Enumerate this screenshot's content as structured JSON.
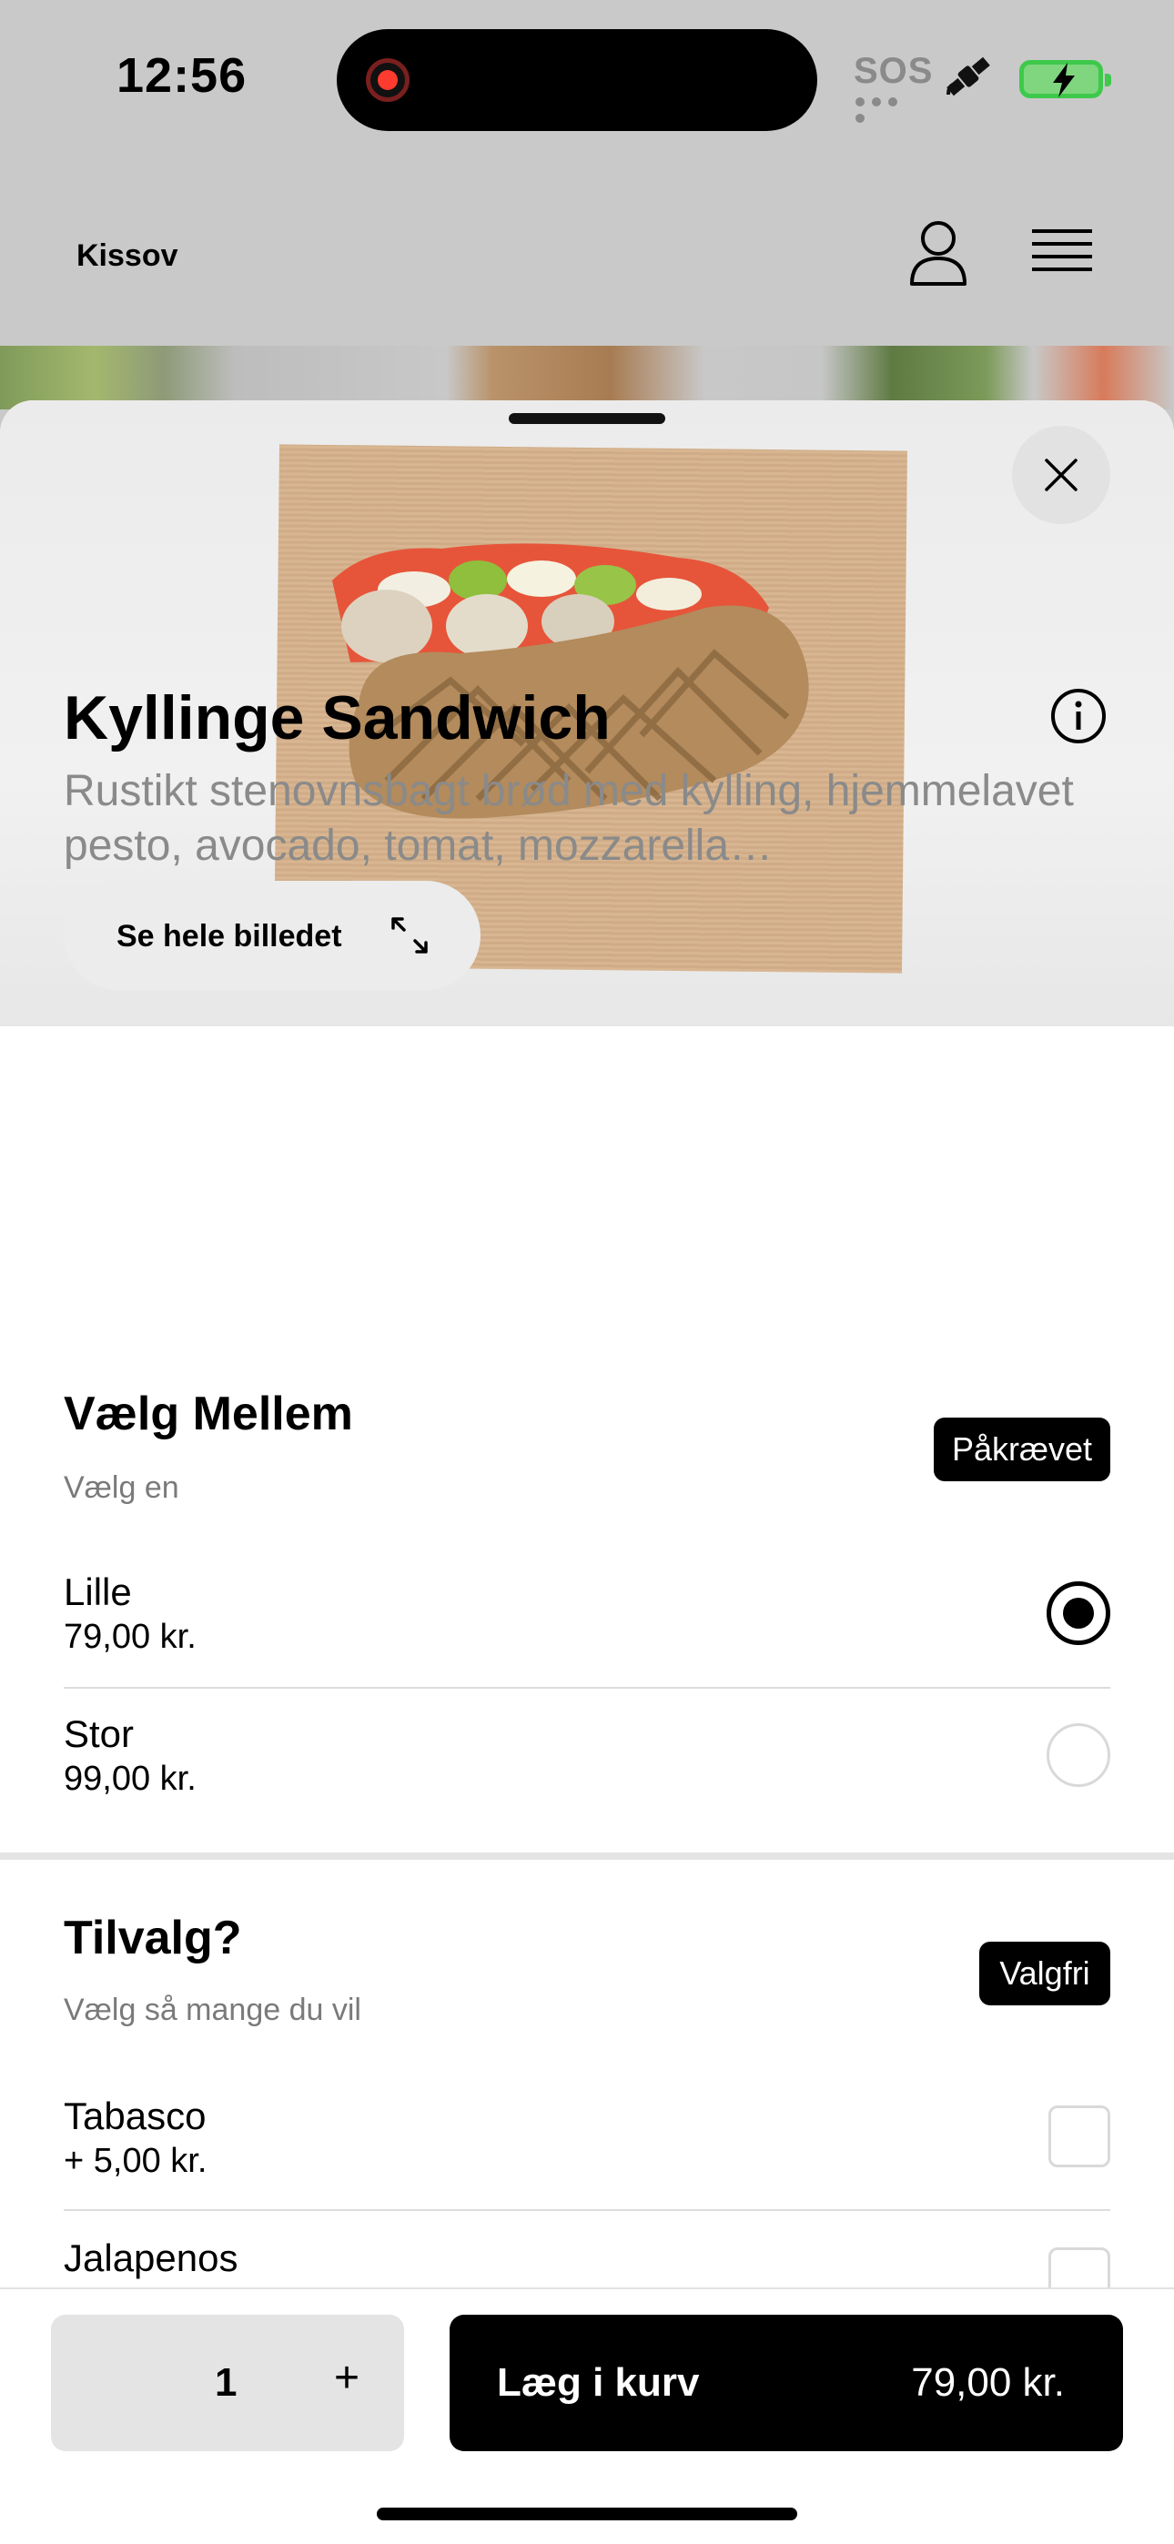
{
  "status_bar": {
    "time": "12:56",
    "sos": "SOS",
    "icons": [
      "recording-indicator",
      "satellite-icon",
      "battery-charging-icon"
    ]
  },
  "header": {
    "brand": "Kissov",
    "icons": [
      "profile-icon",
      "menu-icon"
    ]
  },
  "hero": {
    "expand_label": "Se hele billedet",
    "icons": [
      "close-icon",
      "expand-icon"
    ]
  },
  "product": {
    "title": "Kyllinge Sandwich",
    "description": "Rustikt stenovnsbagt brød med kylling, hjemmelavet pesto, avocado, tomat, mozzarella…"
  },
  "size_section": {
    "title": "Vælg Mellem",
    "subtitle": "Vælg en",
    "badge": "Påkrævet",
    "options": [
      {
        "name": "Lille",
        "price": "79,00 kr.",
        "selected": true
      },
      {
        "name": "Stor",
        "price": "99,00 kr.",
        "selected": false
      }
    ]
  },
  "extras_section": {
    "title": "Tilvalg?",
    "subtitle": "Vælg så mange du vil",
    "badge": "Valgfri",
    "options": [
      {
        "name": "Tabasco",
        "price": "+ 5,00 kr.",
        "checked": false
      },
      {
        "name": "Jalapenos",
        "price": "",
        "checked": false
      }
    ]
  },
  "bottom_bar": {
    "quantity": "1",
    "plus": "+",
    "add_label": "Læg i kurv",
    "add_price": "79,00 kr."
  },
  "colors": {
    "primary": "#000000",
    "muted_text": "#8a8a8a",
    "backdrop": "#c9c9c9",
    "battery": "#3ec94b",
    "recording": "#ff3b30"
  }
}
